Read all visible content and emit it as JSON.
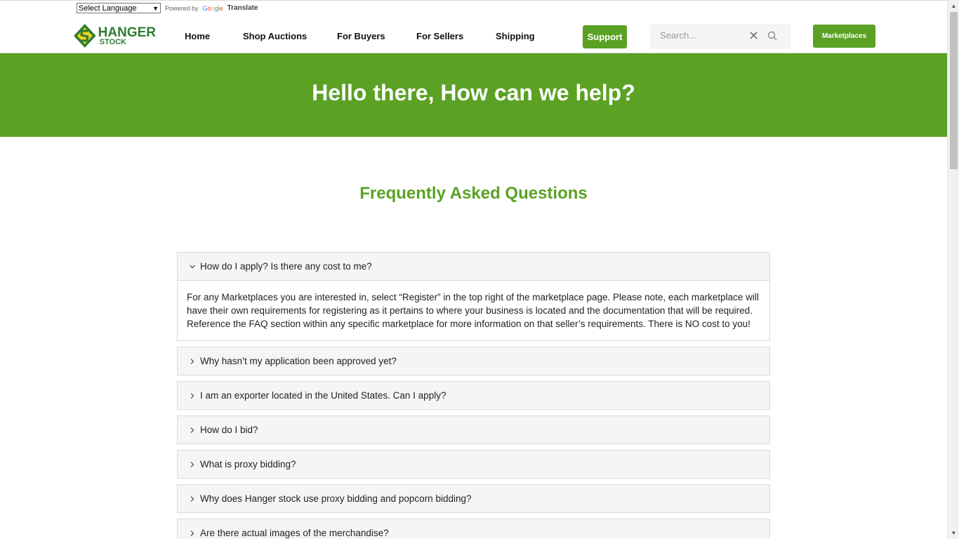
{
  "translate": {
    "language_select": "Select Language",
    "powered_by": "Powered by",
    "google": "Google",
    "translate_label": "Translate"
  },
  "logo": {
    "line1": "HANGER",
    "line2": "STOCK"
  },
  "nav": {
    "items": [
      {
        "label": "Home"
      },
      {
        "label": "Shop Auctions"
      },
      {
        "label": "For Buyers"
      },
      {
        "label": "For Sellers"
      },
      {
        "label": "Shipping"
      }
    ]
  },
  "header": {
    "support_label": "Support",
    "search_placeholder": "Search...",
    "marketplaces_label": "Marketplaces"
  },
  "hero": {
    "title": "Hello there, How can we help?"
  },
  "faq": {
    "title": "Frequently Asked Questions",
    "items": [
      {
        "question": "How do I apply? Is there any cost to me?",
        "expanded": true,
        "answer": "For any Marketplaces you are interested in, select “Register” in the top right of the marketplace page. Please note, each marketplace will have their own requirements for registering as it pertains to where your business is located and the documentation that will be required. Reference the FAQ section within any specific marketplace for more information on that seller’s requirements. There is NO cost to you!"
      },
      {
        "question": "Why hasn’t my application been approved yet?",
        "expanded": false
      },
      {
        "question": "I am an exporter located in the United States. Can I apply?",
        "expanded": false
      },
      {
        "question": "How do I bid?",
        "expanded": false
      },
      {
        "question": "What is proxy bidding?",
        "expanded": false
      },
      {
        "question": "Why does Hanger stock use proxy bidding and popcorn bidding?",
        "expanded": false
      },
      {
        "question": "Are there actual images of the merchandise?",
        "expanded": false
      }
    ]
  },
  "colors": {
    "brand_green": "#5aa124",
    "logo_green": "#2e7d32",
    "logo_yellow": "#f2d21b"
  }
}
